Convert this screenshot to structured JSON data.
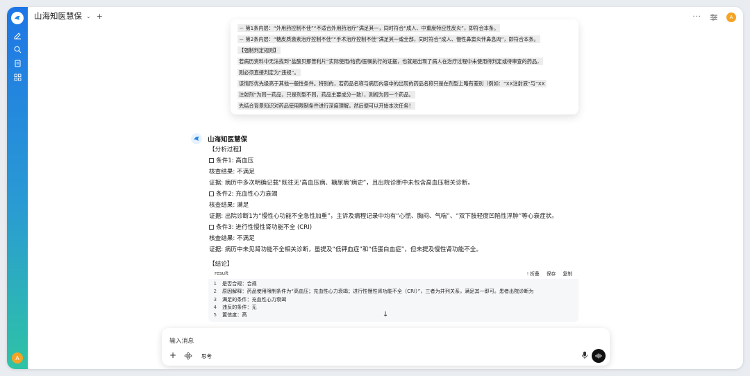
{
  "app": {
    "title": "山海知医慧保",
    "chevron": "⌄",
    "new_tab": "+",
    "more": "···",
    "user_initial": "A"
  },
  "prompt": {
    "lines": [
      "－ 第1条内层：“外用药控制不佳”“不适合外用药治疗”满足其一，同时符合“成人、中重度特应性皮炎”，即符合本条。",
      "－ 第2条内层：“糖皮质激素治疗控制不佳”“手术治疗控制不佳”满足其一或全部，同时符合“成人、慢性鼻窦炎伴鼻息肉”，即符合本条。",
      "【强制判定规则】",
      "若病历资料中无法找到“盐酸贝那普利片”实际使用/给药/医嘱执行的证据，也就是出现了病人在治疗过程中未使用待判定或待审查的药品，",
      "则必须直接判定为“违规”。",
      "该情形优先级高于其他一般性条件。特别的，若药品名称与病历内容中的出现的药品名称只是在剂型上略有差别（例如：“XX注射液”与“XX",
      "注射剂”为同一药品，只是剂型不同，药品主要成分一致），则视为同一个药品。",
      "先结合背景知识对药品使用限制条件进行深度理解，然后便可以开始本次任务！"
    ]
  },
  "assistant": {
    "name": "山海知医慧保",
    "lines": [
      "【分析过程】",
      "条件1: 高血压",
      "核查结果: 不满足",
      "证据: 病历中多次明确记载“既往无‘高血压病、糖尿病’病史”，且出院诊断中未包含高血压相关诊断。",
      "条件2: 充血性心力衰竭",
      "核查结果: 满足",
      "证据: 出院诊断1为“慢性心功能不全急性加重”，主诉及病程记录中均有“心慌、胸闷、气喘”、“双下肢轻度凹陷性浮肿”等心衰症状。",
      "条件3: 进行性慢性肾功能不全 (CRI)",
      "核查结果: 不满足",
      "证据: 病历中未见肾功能不全相关诊断，虽提及“低钾血症”和“低蛋白血症”，但未提及慢性肾功能不全。",
      "【结论】"
    ]
  },
  "code": {
    "lang": "result",
    "actions": [
      "折叠",
      "保存",
      "复制"
    ],
    "rows": [
      {
        "n": "1",
        "t": "是否合规：合规"
      },
      {
        "n": "2",
        "t": "原因解释：药品使用限制条件为“高血压；充血性心力衰竭；进行性慢性肾功能不全（CRI）”，三者为并列关系，满足其一即可。患者出院诊断为"
      },
      {
        "n": "3",
        "t": "满足的条件：充血性心力衰竭"
      },
      {
        "n": "4",
        "t": "违反的条件：无"
      },
      {
        "n": "5",
        "t": "置信度：高"
      }
    ]
  },
  "composer": {
    "placeholder": "输入消息",
    "add": "+",
    "think_label": "思考"
  },
  "colors": {
    "rail_top": "#1e76e6",
    "rail_bottom": "#2ec3a5",
    "avatar": "#f5a324"
  },
  "icons": [
    "app-logo-icon",
    "edit-icon",
    "search-icon",
    "document-icon",
    "grid-icon",
    "more-icon",
    "settings-sliders-icon",
    "arrow-down-icon",
    "atom-icon",
    "mic-icon",
    "voice-wave-icon"
  ]
}
